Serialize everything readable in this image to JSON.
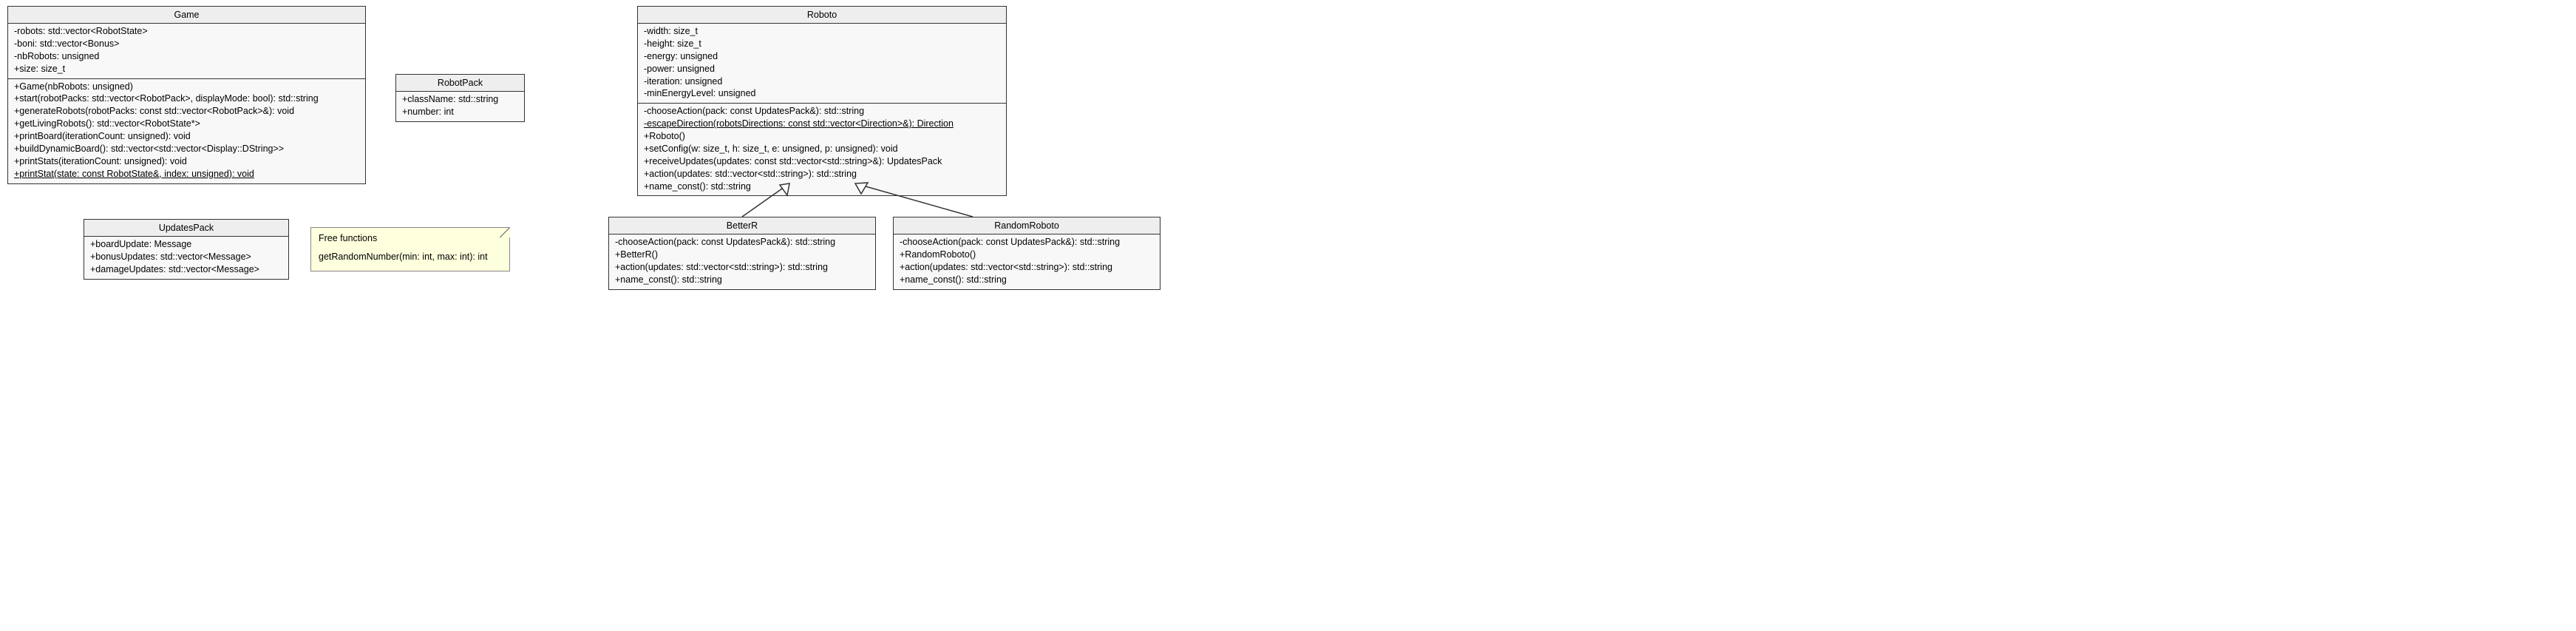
{
  "classes": {
    "game": {
      "name": "Game",
      "attrs": [
        "-robots: std::vector<RobotState>",
        "-boni: std::vector<Bonus>",
        "-nbRobots: unsigned",
        "+size: size_t"
      ],
      "ops": [
        "+Game(nbRobots: unsigned)",
        "+start(robotPacks: std::vector<RobotPack>, displayMode: bool): std::string",
        "+generateRobots(robotPacks: const std::vector<RobotPack>&): void",
        "+getLivingRobots(): std::vector<RobotState*>",
        "+printBoard(iterationCount: unsigned): void",
        "+buildDynamicBoard(): std::vector<std::vector<Display::DString>>",
        "+printStats(iterationCount: unsigned): void",
        "+printStat(state: const RobotState&, index: unsigned): void"
      ],
      "staticOps": [
        7
      ]
    },
    "robotPack": {
      "name": "RobotPack",
      "attrs": [
        "+className: std::string",
        "+number: int"
      ],
      "ops": []
    },
    "updatesPack": {
      "name": "UpdatesPack",
      "attrs": [
        "+boardUpdate: Message",
        "+bonusUpdates: std::vector<Message>",
        "+damageUpdates: std::vector<Message>"
      ],
      "ops": []
    },
    "roboto": {
      "name": "Roboto",
      "attrs": [
        "-width: size_t",
        "-height: size_t",
        "-energy: unsigned",
        "-power: unsigned",
        "-iteration: unsigned",
        "-minEnergyLevel: unsigned"
      ],
      "ops": [
        "-chooseAction(pack: const UpdatesPack&): std::string",
        "-escapeDirection(robotsDirections: const std::vector<Direction>&): Direction",
        "+Roboto()",
        "+setConfig(w: size_t, h: size_t, e: unsigned, p: unsigned): void",
        "+receiveUpdates(updates: const std::vector<std::string>&): UpdatesPack",
        "+action(updates: std::vector<std::string>): std::string",
        "+name_const(): std::string"
      ],
      "staticOps": [
        1
      ]
    },
    "betterR": {
      "name": "BetterR",
      "attrs": [],
      "ops": [
        "-chooseAction(pack: const UpdatesPack&): std::string",
        "+BetterR()",
        "+action(updates: std::vector<std::string>): std::string",
        "+name_const(): std::string"
      ]
    },
    "randomRoboto": {
      "name": "RandomRoboto",
      "attrs": [],
      "ops": [
        "-chooseAction(pack: const UpdatesPack&): std::string",
        "+RandomRoboto()",
        "+action(updates: std::vector<std::string>): std::string",
        "+name_const(): std::string"
      ]
    }
  },
  "note": {
    "title": "Free functions",
    "body": "getRandomNumber(min: int, max: int): int"
  }
}
